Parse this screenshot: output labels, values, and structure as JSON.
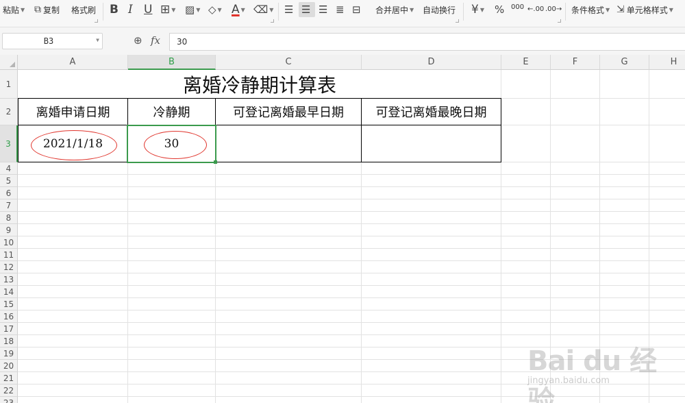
{
  "toolbar": {
    "paste": "粘贴",
    "copy": "复制",
    "format_painter": "格式刷",
    "bold": "B",
    "italic": "I",
    "underline": "U",
    "font_color_glyph": "A",
    "merge_center": "合并居中",
    "wrap_text": "自动换行",
    "currency": "¥",
    "percent": "%",
    "thousands": "000",
    "inc_decimal": ".00",
    "dec_decimal": ".00",
    "conditional_format": "条件格式",
    "cell_style": "单元格样式",
    "font_color": "#e0342c"
  },
  "formula_bar": {
    "name_box": "B3",
    "fx": "fx",
    "content": "30"
  },
  "columns": [
    "A",
    "B",
    "C",
    "D",
    "E",
    "F",
    "G",
    "H"
  ],
  "rows": [
    "1",
    "2",
    "3",
    "4",
    "5",
    "6",
    "7",
    "8",
    "9",
    "10",
    "11",
    "12",
    "13",
    "14",
    "15",
    "16",
    "17",
    "18",
    "19",
    "20",
    "21",
    "22",
    "23"
  ],
  "active_cell": "B3",
  "sheet": {
    "title": "离婚冷静期计算表",
    "headers": [
      "离婚申请日期",
      "冷静期",
      "可登记离婚最早日期",
      "可登记离婚最晚日期"
    ],
    "row3": [
      "2021/1/18",
      "30",
      "",
      ""
    ]
  },
  "watermark": {
    "logo": "Bai du 经验",
    "url": "jingyan.baidu.com"
  },
  "colors": {
    "accent": "#3a9a4c",
    "annotation": "#e0342c"
  }
}
